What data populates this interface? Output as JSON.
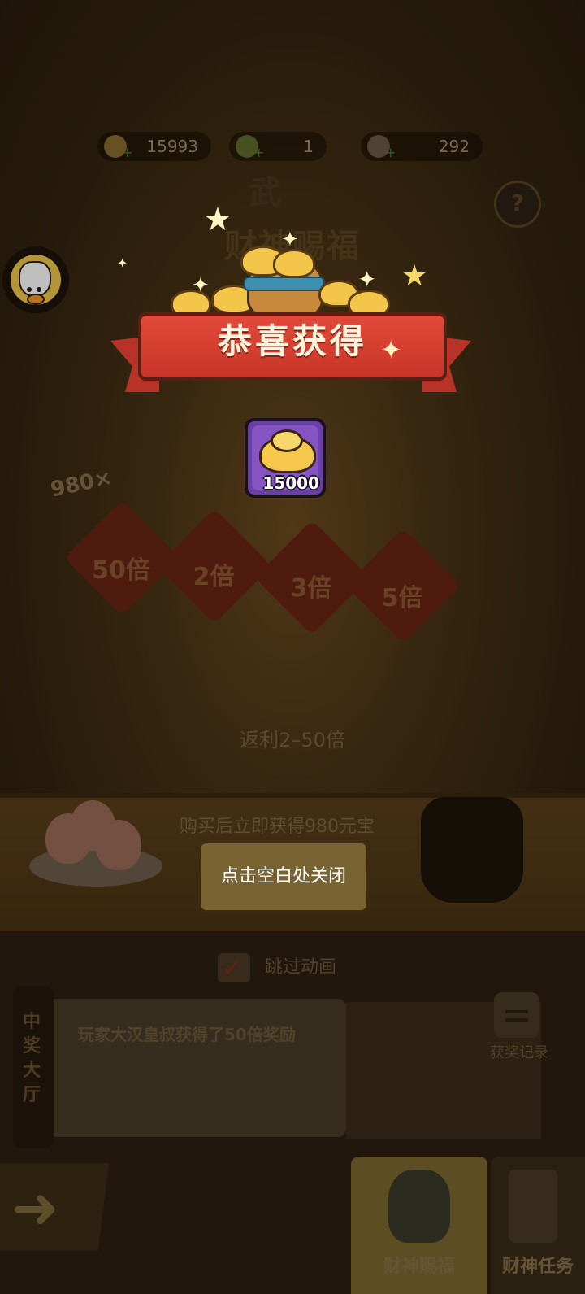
{
  "resources": [
    {
      "name": "yuanbao-icon",
      "value": "15993"
    },
    {
      "name": "leaf-icon",
      "value": "1"
    },
    {
      "name": "token-icon",
      "value": "292"
    }
  ],
  "game": {
    "title": "财神赐福",
    "banner_top": "武",
    "note": "980×",
    "multipliers": [
      "50倍",
      "2倍",
      "3倍",
      "5倍"
    ],
    "rebate": "返利2–50倍",
    "buy_text": "购买后立即获得980元宝"
  },
  "skip_animation": "跳过动画",
  "hall": {
    "label": "中奖大厅",
    "message": "玩家大汉皇叔获得了50倍奖励"
  },
  "record_label": "获奖记录",
  "tabs": [
    {
      "label": "财神赐福"
    },
    {
      "label": "财神任务"
    }
  ],
  "popup": {
    "title": "恭喜获得",
    "item_qty": "15000",
    "close_hint": "点击空白处关闭"
  },
  "colors": {
    "ribbon": "#d83f30",
    "item_frame": "#8654c3",
    "gold": "#f3c64a"
  }
}
